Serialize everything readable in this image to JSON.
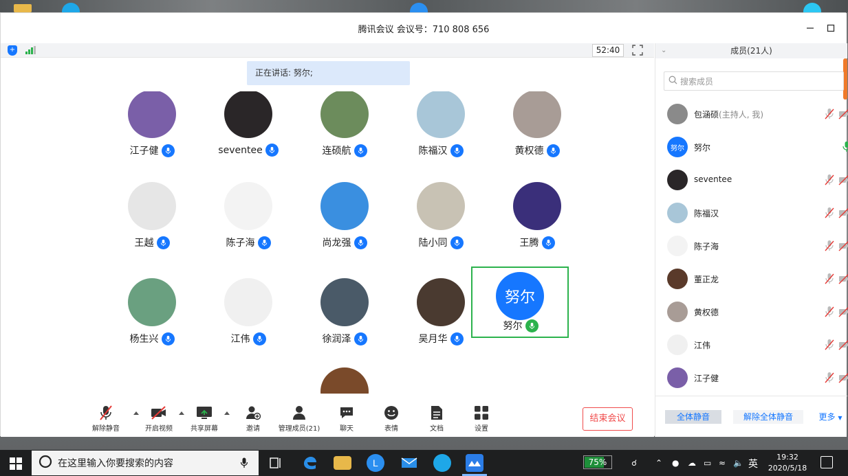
{
  "window": {
    "title": "腾讯会议 会议号：710 808 656",
    "minimize_icon": "minimize-icon",
    "maximize_icon": "maximize-icon"
  },
  "topbar": {
    "timer": "52:40"
  },
  "speaking": {
    "text": "正在讲话: 努尔;"
  },
  "participants": [
    {
      "name": "江子健",
      "avatar_color": "#7a5fa8"
    },
    {
      "name": "seventee",
      "avatar_color": "#2a2628"
    },
    {
      "name": "连硕航",
      "avatar_color": "#6c8c5c"
    },
    {
      "name": "陈福汉",
      "avatar_color": "#a8c6d8"
    },
    {
      "name": "黄权德",
      "avatar_color": "#a89c96"
    },
    {
      "name": "王越",
      "avatar_color": "#e6e6e6"
    },
    {
      "name": "陈子海",
      "avatar_color": "#f3f3f3"
    },
    {
      "name": "尚龙强",
      "avatar_color": "#3a8fe0"
    },
    {
      "name": "陆小同",
      "avatar_color": "#c8c2b4"
    },
    {
      "name": "王腾",
      "avatar_color": "#3a2f7a"
    },
    {
      "name": "杨生兴",
      "avatar_color": "#6aa080"
    },
    {
      "name": "江伟",
      "avatar_color": "#f0f0f0"
    },
    {
      "name": "徐润泽",
      "avatar_color": "#4a5a68"
    },
    {
      "name": "吴月华",
      "avatar_color": "#4a3a30"
    },
    {
      "name": "努尔",
      "avatar_text": "努尔",
      "avatar_color": "#1677ff"
    },
    {
      "name": "",
      "avatar_color": "#7a4a2a"
    }
  ],
  "toolbar": {
    "unmute": "解除静音",
    "video": "开启视频",
    "share": "共享屏幕",
    "invite": "邀请",
    "manage": "管理成员(21)",
    "chat": "聊天",
    "emoji": "表情",
    "docs": "文档",
    "settings": "设置",
    "end": "结束会议"
  },
  "members_panel": {
    "header": "成员(21人)",
    "search_placeholder": "搜索成员",
    "members": [
      {
        "name": "包涵硕",
        "role": "(主持人, 我)",
        "avatar_color": "#8a8a8a",
        "mic": "muted"
      },
      {
        "name": "努尔",
        "role": "",
        "avatar_text": "努尔",
        "avatar_color": "#1677ff",
        "mic": "active"
      },
      {
        "name": "seventee",
        "role": "",
        "avatar_color": "#2a2628",
        "mic": "muted"
      },
      {
        "name": "陈福汉",
        "role": "",
        "avatar_color": "#a8c6d8",
        "mic": "muted"
      },
      {
        "name": "陈子海",
        "role": "",
        "avatar_color": "#f3f3f3",
        "mic": "muted"
      },
      {
        "name": "董正龙",
        "role": "",
        "avatar_color": "#5a3a2a",
        "mic": "muted"
      },
      {
        "name": "黄权德",
        "role": "",
        "avatar_color": "#a89c96",
        "mic": "muted"
      },
      {
        "name": "江伟",
        "role": "",
        "avatar_color": "#f0f0f0",
        "mic": "muted"
      },
      {
        "name": "江子健",
        "role": "",
        "avatar_color": "#7a5fa8",
        "mic": "muted"
      }
    ],
    "mute_all": "全体静音",
    "unmute_all": "解除全体静音",
    "more": "更多"
  },
  "taskbar": {
    "search_placeholder": "在这里输入你要搜索的内容",
    "battery": "75%",
    "ime": "英",
    "time": "19:32",
    "date": "2020/5/18"
  }
}
